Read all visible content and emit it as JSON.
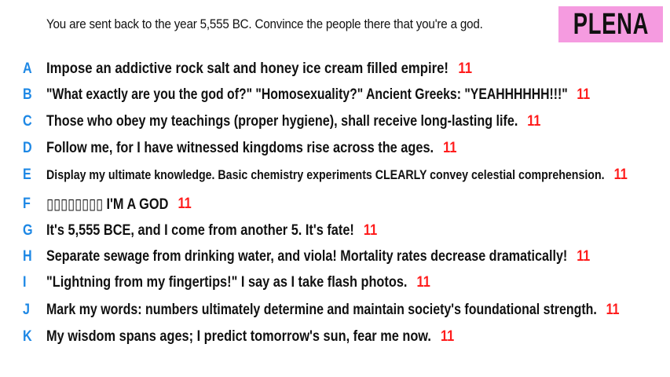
{
  "prompt": "You are sent back to the year 5,555 BC. Convince the people there that you're a god.",
  "badge": "PLENA",
  "answers": [
    {
      "letter": "A",
      "text": "Impose an addictive rock salt and honey ice cream filled empire!",
      "score": "11"
    },
    {
      "letter": "B",
      "text": "\"What exactly are you the god of?\" \"Homosexuality?\" Ancient Greeks: \"YEAHHHHHH!!!\"",
      "score": "11"
    },
    {
      "letter": "C",
      "text": "Those who obey my teachings (proper hygiene), shall receive long-lasting life.",
      "score": "11"
    },
    {
      "letter": "D",
      "text": "Follow me, for I have witnessed kingdoms rise across the ages.",
      "score": "11"
    },
    {
      "letter": "E",
      "text": "Display my ultimate knowledge. Basic chemistry experiments CLEARLY convey celestial comprehension.",
      "score": "11"
    },
    {
      "letter": "F",
      "text": "▯▯▯▯▯▯▯▯ I'M A GOD",
      "score": "11"
    },
    {
      "letter": "G",
      "text": "It's 5,555 BCE, and I come from another 5. It's fate!",
      "score": "11"
    },
    {
      "letter": "H",
      "text": "Separate sewage from drinking water, and viola! Mortality rates decrease dramatically!",
      "score": "11"
    },
    {
      "letter": "I",
      "text": "\"Lightning from my fingertips!\" I say as I take flash photos.",
      "score": "11"
    },
    {
      "letter": "J",
      "text": "Mark my words: numbers ultimately determine and maintain society's foundational strength.",
      "score": "11"
    },
    {
      "letter": "K",
      "text": "My wisdom spans ages; I predict tomorrow's sun, fear me now.",
      "score": "11"
    }
  ]
}
